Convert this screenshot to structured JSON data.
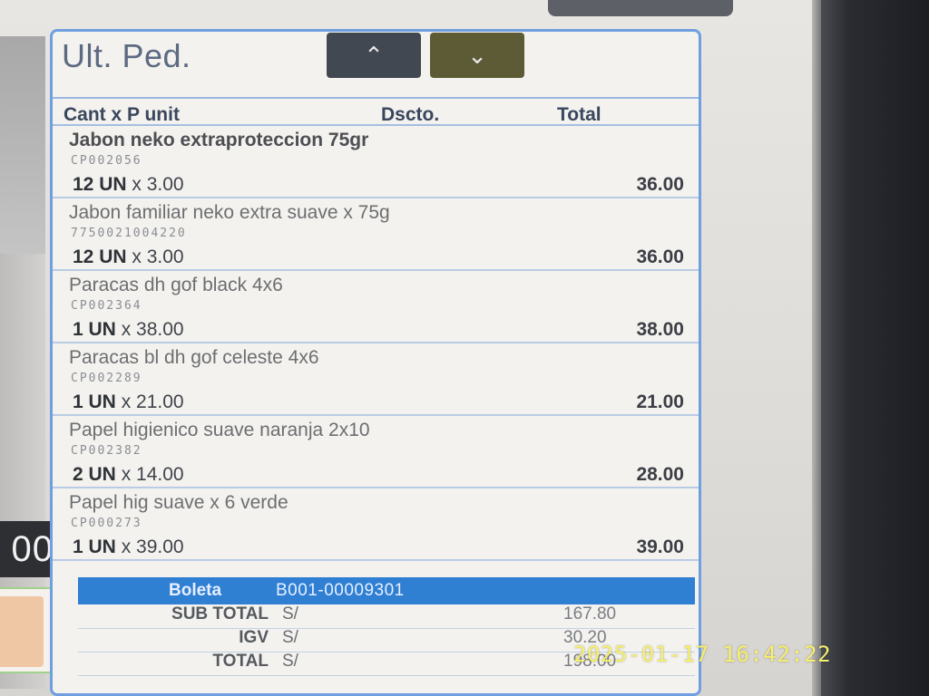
{
  "panel": {
    "title": "Ult. Ped.",
    "nav_up": "⌃",
    "nav_down": "⌄"
  },
  "columns": {
    "qty_price": "Cant x P unit",
    "discount": "Dscto.",
    "total": "Total"
  },
  "items": [
    {
      "name": "Jabon neko extraproteccion 75gr",
      "code": "CP002056",
      "qty": "12 UN",
      "price": "x 3.00",
      "total": "36.00"
    },
    {
      "name": "Jabon familiar neko extra suave x 75g",
      "code": "7750021004220",
      "qty": "12 UN",
      "price": "x 3.00",
      "total": "36.00"
    },
    {
      "name": "Paracas dh gof black 4x6",
      "code": "CP002364",
      "qty": "1 UN",
      "price": "x 38.00",
      "total": "38.00"
    },
    {
      "name": "Paracas bl dh gof celeste 4x6",
      "code": "CP002289",
      "qty": "1 UN",
      "price": "x 21.00",
      "total": "21.00"
    },
    {
      "name": "Papel higienico suave naranja 2x10",
      "code": "CP002382",
      "qty": "2 UN",
      "price": "x 14.00",
      "total": "28.00"
    },
    {
      "name": "Papel hig suave x 6 verde",
      "code": "CP000273",
      "qty": "1 UN",
      "price": "x 39.00",
      "total": "39.00"
    }
  ],
  "boleta": {
    "label": "Boleta",
    "number": "B001-00009301"
  },
  "summary": {
    "subtotal_label": "SUB TOTAL",
    "subtotal_currency": "S/",
    "subtotal_value": "167.80",
    "igv_label": "IGV",
    "igv_currency": "S/",
    "igv_value": "30.20",
    "total_label": "TOTAL",
    "total_currency": "S/",
    "total_value": "198.00"
  },
  "left_panel": {
    "amount_fragment": "00"
  },
  "timestamp": "2025-01-17 16:42:22",
  "colors": {
    "accent_blue": "#2f7fd3",
    "panel_border": "#6f9fe0",
    "timestamp_yellow": "#f7f06a"
  }
}
